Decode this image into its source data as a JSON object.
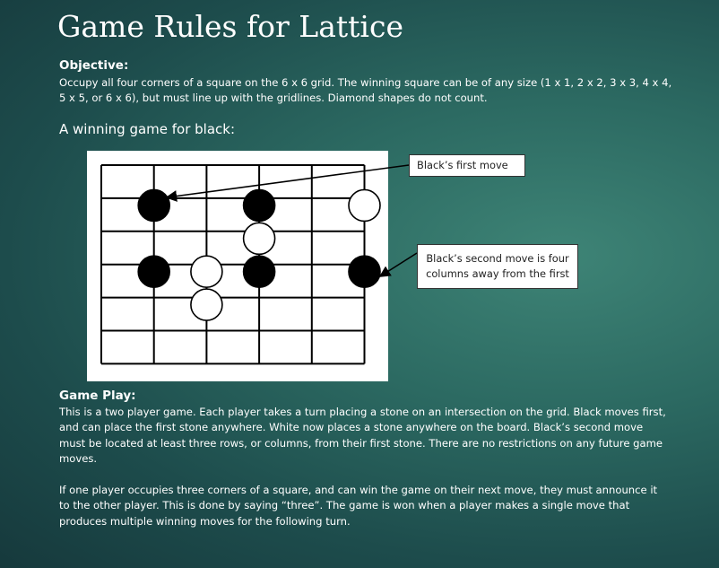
{
  "title": "Game Rules for Lattice",
  "objective": {
    "heading": "Objective:",
    "lines": [
      "Occupy all four corners of a square on the 6 x 6 grid. The winning square can be of any size (1 x 1, 2 x 2, 3 x 3, 4 x 4,",
      "5 x 5, or 6 x 6), but must line up with the gridlines. Diamond shapes do not count."
    ]
  },
  "example_heading": "A winning game for black:",
  "board": {
    "grid": "6 x 6",
    "black_stones": [
      [
        1,
        1
      ],
      [
        3,
        1
      ],
      [
        1,
        3
      ],
      [
        3,
        3
      ],
      [
        5,
        3
      ]
    ],
    "white_stones": [
      [
        5,
        1
      ],
      [
        3,
        2
      ],
      [
        2,
        3
      ],
      [
        2,
        4
      ]
    ],
    "callouts": [
      "Black’s first move",
      "Black’s second move is four columns away from the first"
    ],
    "callout_lines": [
      [
        "Black’s second move is four",
        "columns away from the first"
      ]
    ]
  },
  "gameplay": {
    "heading": "Game Play:",
    "paragraph1": [
      "This is a two player game. Each player takes a turn placing a stone on an intersection on the grid. Black moves first,",
      "and can place the first stone anywhere. White now places a stone anywhere on the board. Black’s second move",
      "must be located at least three rows, or columns, from their first stone. There are no restrictions on any future game",
      "moves."
    ],
    "paragraph2": [
      "If one player occupies three corners of a square, and can win the game on their next move, they must announce it",
      "to the other player. This is done by saying “three”. The game is won when a player makes a single move that",
      "produces multiple winning moves for the following turn."
    ]
  }
}
